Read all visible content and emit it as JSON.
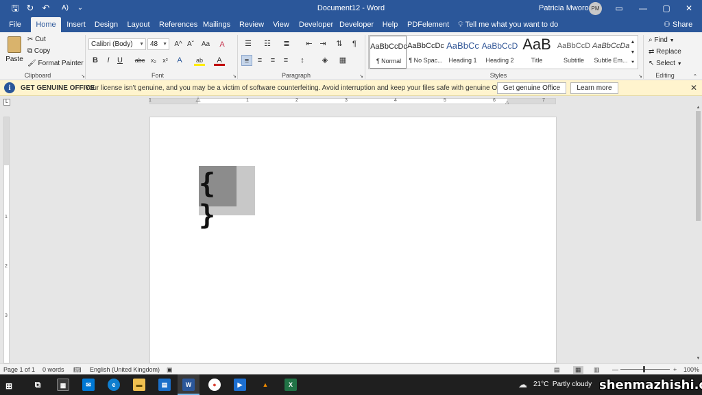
{
  "titlebar": {
    "doc_title": "Document12 - Word",
    "user_name": "Patricia Mworozi",
    "user_initials": "PM",
    "qa_save": "🖫",
    "qa_autosave": "↻",
    "qa_undo": "↶",
    "qa_read": "A)",
    "qa_more": "⌄",
    "win_display": "▭",
    "win_min": "—",
    "win_max": "▢",
    "win_close": "✕"
  },
  "tabs": [
    "File",
    "Home",
    "Insert",
    "Design",
    "Layout",
    "References",
    "Mailings",
    "Review",
    "View",
    "Developer",
    "Developer",
    "Help",
    "PDFelement"
  ],
  "tell_me": "Tell me what you want to do",
  "share_label": "Share",
  "clipboard": {
    "paste": "Paste",
    "cut": "Cut",
    "copy": "Copy",
    "format_painter": "Format Painter",
    "group": "Clipboard"
  },
  "font": {
    "name": "Calibri (Body)",
    "size": "48",
    "group": "Font",
    "bold": "B",
    "italic": "I",
    "underline": "U",
    "strike": "abc",
    "sub": "x₂",
    "sup": "x²",
    "grow": "A^",
    "shrink": "Aˇ",
    "case": "Aa",
    "clear": "A",
    "effects": "A",
    "highlight": "ab",
    "color": "A"
  },
  "paragraph": {
    "group": "Paragraph"
  },
  "styles": {
    "group": "Styles",
    "items": [
      {
        "sample": "AaBbCcDc",
        "name": "¶ Normal"
      },
      {
        "sample": "AaBbCcDc",
        "name": "¶ No Spac..."
      },
      {
        "sample": "AaBbCc",
        "name": "Heading 1"
      },
      {
        "sample": "AaBbCcD",
        "name": "Heading 2"
      },
      {
        "sample": "AaB",
        "name": "Title"
      },
      {
        "sample": "AaBbCcD",
        "name": "Subtitle"
      },
      {
        "sample": "AaBbCcDa",
        "name": "Subtle Em..."
      }
    ]
  },
  "editing": {
    "group": "Editing",
    "find": "Find",
    "replace": "Replace",
    "select": "Select"
  },
  "notice": {
    "title": "GET GENUINE OFFICE",
    "message": "Your license isn't genuine, and you may be a victim of software counterfeiting. Avoid interruption and keep your files safe with genuine Office today.",
    "primary_button": "Get genuine Office",
    "secondary_button": "Learn more",
    "close": "✕"
  },
  "ruler": {
    "numbers": [
      "1",
      "1",
      "2",
      "3",
      "4",
      "5",
      "6",
      "7"
    ],
    "vnumbers": [
      "1",
      "2",
      "3"
    ]
  },
  "document": {
    "field_text": "{ }"
  },
  "status": {
    "page": "Page 1 of 1",
    "words": "0 words",
    "language": "English (United Kingdom)",
    "zoom": "100%",
    "zoom_minus": "—",
    "zoom_plus": "+"
  },
  "taskbar": {
    "weather_temp": "21°C",
    "weather_desc": "Partly cloudy",
    "watermark": "shenmazhishi.com"
  },
  "colors": {
    "accent": "#2b579a",
    "notice_bg": "#fff4ce",
    "taskbar": "#1f1f1f"
  }
}
